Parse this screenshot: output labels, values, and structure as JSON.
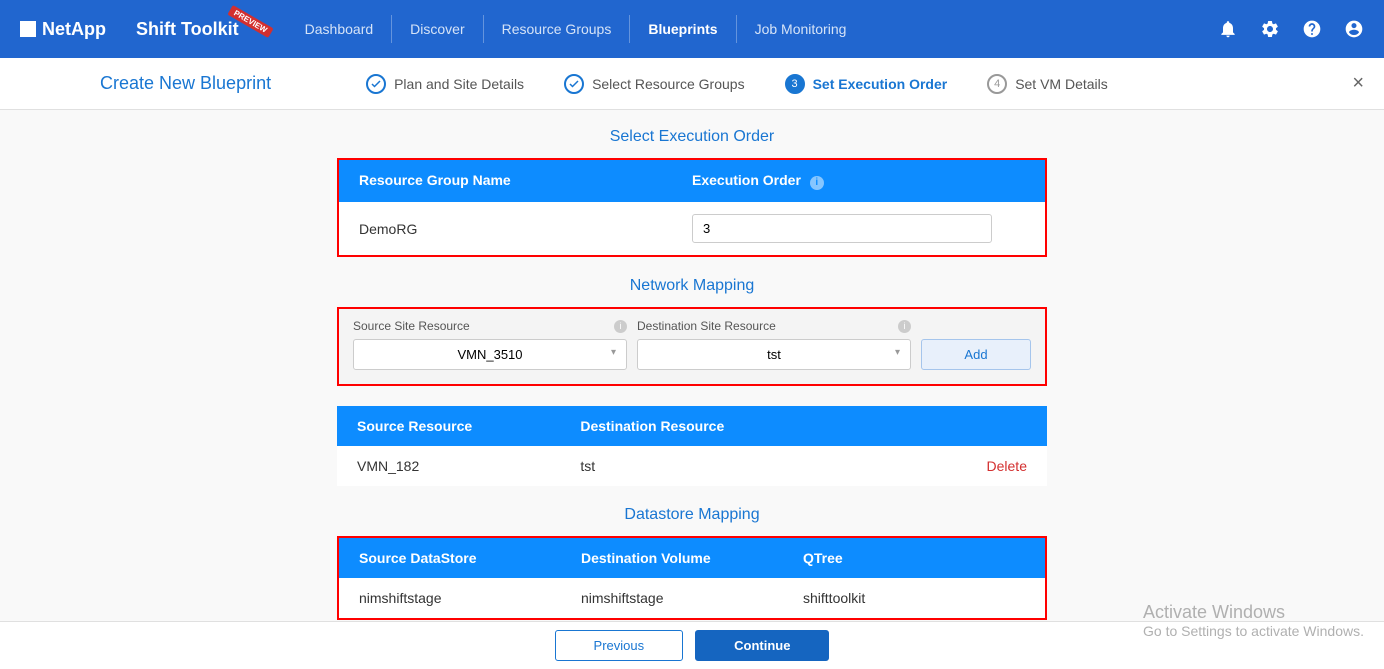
{
  "header": {
    "brand": "NetApp",
    "app_name": "Shift Toolkit",
    "preview_badge": "PREVIEW",
    "nav": [
      "Dashboard",
      "Discover",
      "Resource Groups",
      "Blueprints",
      "Job Monitoring"
    ]
  },
  "wizard": {
    "title": "Create New Blueprint",
    "steps": [
      {
        "label": "Plan and Site Details",
        "state": "done"
      },
      {
        "label": "Select Resource Groups",
        "state": "done"
      },
      {
        "num": "3",
        "label": "Set Execution Order",
        "state": "active"
      },
      {
        "num": "4",
        "label": "Set VM Details",
        "state": "pending"
      }
    ]
  },
  "execution": {
    "title": "Select Execution Order",
    "headers": {
      "rg": "Resource Group Name",
      "order": "Execution Order"
    },
    "row": {
      "name": "DemoRG",
      "value": "3"
    }
  },
  "network": {
    "title": "Network Mapping",
    "src_label": "Source Site Resource",
    "dst_label": "Destination Site Resource",
    "src_value": "VMN_3510",
    "dst_value": "tst",
    "add_label": "Add",
    "table_headers": {
      "src": "Source Resource",
      "dst": "Destination Resource"
    },
    "row": {
      "src": "VMN_182",
      "dst": "tst",
      "action": "Delete"
    }
  },
  "datastore": {
    "title": "Datastore Mapping",
    "headers": {
      "src": "Source DataStore",
      "vol": "Destination Volume",
      "qt": "QTree"
    },
    "row": {
      "src": "nimshiftstage",
      "vol": "nimshiftstage",
      "qt": "shifttoolkit"
    }
  },
  "footer": {
    "prev": "Previous",
    "cont": "Continue"
  },
  "watermark": {
    "title": "Activate Windows",
    "sub": "Go to Settings to activate Windows."
  }
}
